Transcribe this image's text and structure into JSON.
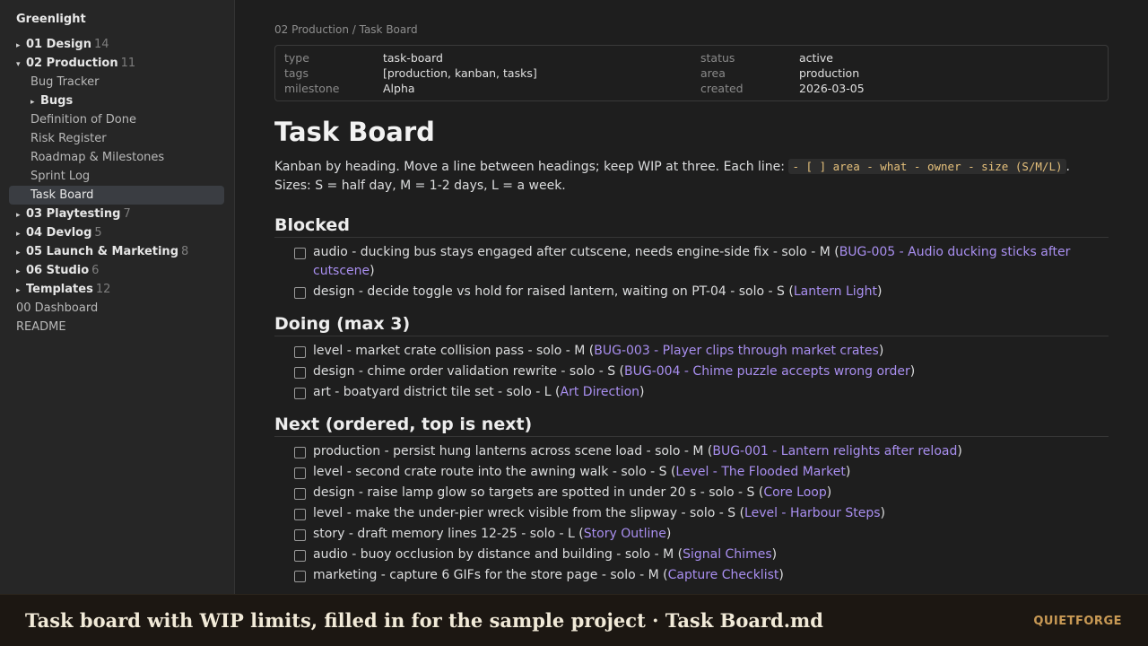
{
  "sidebar": {
    "vault_title": "Greenlight",
    "items": [
      {
        "label": "01 Design",
        "count": "14",
        "arrow": "▸",
        "type": "folder"
      },
      {
        "label": "02 Production",
        "count": "11",
        "arrow": "▾",
        "type": "folder"
      },
      {
        "label": "Bug Tracker",
        "type": "child"
      },
      {
        "label": "Bugs",
        "arrow": "▸",
        "type": "subfolder"
      },
      {
        "label": "Definition of Done",
        "type": "child"
      },
      {
        "label": "Risk Register",
        "type": "child"
      },
      {
        "label": "Roadmap & Milestones",
        "type": "child"
      },
      {
        "label": "Sprint Log",
        "type": "child"
      },
      {
        "label": "Task Board",
        "type": "child",
        "active": true
      },
      {
        "label": "03 Playtesting",
        "count": "7",
        "arrow": "▸",
        "type": "folder"
      },
      {
        "label": "04 Devlog",
        "count": "5",
        "arrow": "▸",
        "type": "folder"
      },
      {
        "label": "05 Launch & Marketing",
        "count": "8",
        "arrow": "▸",
        "type": "folder"
      },
      {
        "label": "06 Studio",
        "count": "6",
        "arrow": "▸",
        "type": "folder"
      },
      {
        "label": "Templates",
        "count": "12",
        "arrow": "▸",
        "type": "folder"
      },
      {
        "label": "00 Dashboard",
        "type": "file"
      },
      {
        "label": "README",
        "type": "file"
      }
    ]
  },
  "breadcrumb": "02 Production / Task Board",
  "properties": {
    "type_key": "type",
    "type_val": "task-board",
    "status_key": "status",
    "status_val": "active",
    "tags_key": "tags",
    "tags_val": "[production, kanban, tasks]",
    "area_key": "area",
    "area_val": "production",
    "milestone_key": "milestone",
    "milestone_val": "Alpha",
    "created_key": "created",
    "created_val": "2026-03-05"
  },
  "page_title": "Task Board",
  "intro": {
    "text_before": "Kanban by heading. Move a line between headings; keep WIP at three. Each line: ",
    "code": "- [ ] area - what - owner - size (S/M/L)",
    "text_after": ".",
    "line2": "Sizes: S = half day, M = 1-2 days, L = a week."
  },
  "sections": {
    "blocked": {
      "heading": "Blocked",
      "tasks": [
        {
          "text": "audio - ducking bus stays engaged after cutscene, needs engine-side fix - solo - M ",
          "link": "BUG-005 - Audio ducking sticks after cutscene"
        },
        {
          "text": "design - decide toggle vs hold for raised lantern, waiting on PT-04 - solo - S ",
          "link": "Lantern Light"
        }
      ]
    },
    "doing": {
      "heading": "Doing (max 3)",
      "tasks": [
        {
          "text": "level - market crate collision pass - solo - M ",
          "link": "BUG-003 - Player clips through market crates"
        },
        {
          "text": "design - chime order validation rewrite - solo - S ",
          "link": "BUG-004 - Chime puzzle accepts wrong order"
        },
        {
          "text": "art - boatyard district tile set - solo - L ",
          "link": "Art Direction"
        }
      ]
    },
    "next": {
      "heading": "Next (ordered, top is next)",
      "tasks": [
        {
          "text": "production - persist hung lanterns across scene load - solo - M ",
          "link": "BUG-001 - Lantern relights after reload"
        },
        {
          "text": "level - second crate route into the awning walk - solo - S ",
          "link": "Level - The Flooded Market"
        },
        {
          "text": "design - raise lamp glow so targets are spotted in under 20 s - solo - S ",
          "link": "Core Loop"
        },
        {
          "text": "level - make the under-pier wreck visible from the slipway - solo - S ",
          "link": "Level - Harbour Steps"
        },
        {
          "text": "story - draft memory lines 12-25 - solo - L ",
          "link": "Story Outline"
        },
        {
          "text": "audio - buoy occlusion by distance and building - solo - M ",
          "link": "Signal Chimes"
        },
        {
          "text": "marketing - capture 6 GIFs for the store page - solo - M ",
          "link": "Capture Checklist"
        }
      ]
    }
  },
  "footer": {
    "title": "Task board with WIP limits, filled in for the sample project · Task Board.md",
    "brand": "QUIETFORGE"
  },
  "colors": {
    "link": "#a98ff0",
    "code": "#e5c07b",
    "brand": "#c99a55",
    "active_bg": "#3a3d42"
  }
}
